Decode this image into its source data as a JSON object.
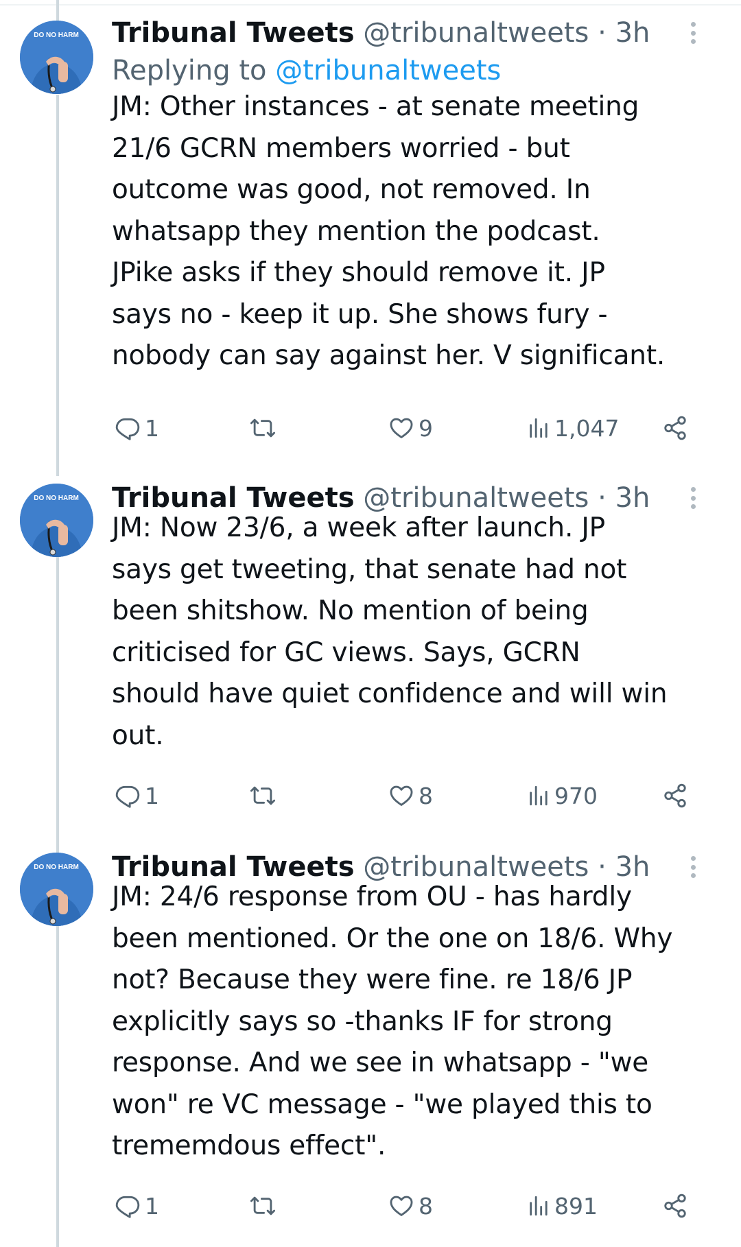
{
  "tweets": [
    {
      "author_name": "Tribunal Tweets",
      "handle": "@tribunaltweets",
      "separator": "·",
      "time": "3h",
      "reply_prefix": "Replying to",
      "reply_mention": "@tribunaltweets",
      "text_lines": [
        "JM: Other instances - at senate meeting",
        "21/6 GCRN members worried - but",
        "outcome was good, not removed. In",
        "whatsapp they mention the podcast.",
        "JPike asks if they should remove it. JP",
        "says no - keep it up. She shows  fury -",
        "nobody can say against her. V significant."
      ],
      "avatar_text": "DO NO HARM",
      "replies": "1",
      "retweets": "",
      "likes": "9",
      "views": "1,047"
    },
    {
      "author_name": "Tribunal Tweets",
      "handle": "@tribunaltweets",
      "separator": "·",
      "time": "3h",
      "text_lines": [
        "JM: Now 23/6, a week after launch. JP",
        "says get tweeting, that senate had not",
        "been shitshow. No mention of being",
        "criticised for GC views. Says, GCRN",
        "should have quiet confidence and will win",
        "out."
      ],
      "avatar_text": "DO NO HARM",
      "replies": "1",
      "retweets": "",
      "likes": "8",
      "views": "970"
    },
    {
      "author_name": "Tribunal Tweets",
      "handle": "@tribunaltweets",
      "separator": "·",
      "time": "3h",
      "text_lines": [
        "JM: 24/6 response from OU - has hardly",
        "been mentioned. Or the one on 18/6. Why",
        "not? Because they were fine. re 18/6 JP",
        "explicitly says so -thanks IF for strong",
        "response. And we see in whatsapp - \"we",
        "won\" re VC message - \"we played this to",
        "trememdous effect\"."
      ],
      "avatar_text": "DO NO HARM",
      "replies": "1",
      "retweets": "",
      "likes": "8",
      "views": "891"
    }
  ],
  "icons": {
    "reply": "reply-icon",
    "retweet": "retweet-icon",
    "like": "heart-icon",
    "views": "views-bar-chart-icon",
    "share": "share-icon",
    "more": "more-options-icon"
  },
  "colors": {
    "text": "#0f1419",
    "secondary": "#536471",
    "link": "#1d9bf0",
    "thread_line": "#cfd9de",
    "avatar_bg": "#4a86cf"
  }
}
